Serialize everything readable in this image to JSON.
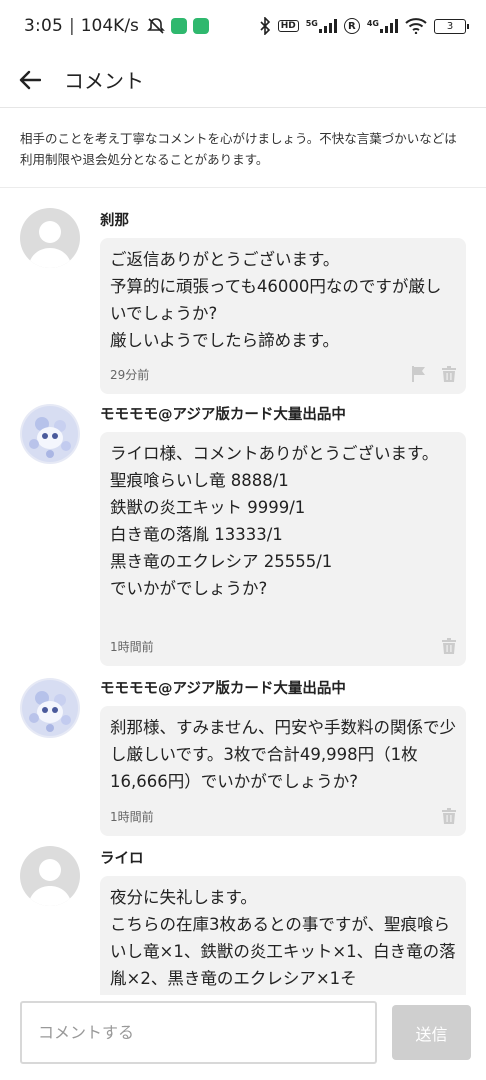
{
  "status_bar": {
    "time": "3:05",
    "separator": "|",
    "network_speed": "104K/s",
    "battery_level": "3",
    "hd_label": "HD",
    "sig1_label": "5G",
    "sig2_label": "4G",
    "r_label": "R",
    "icons": [
      "muted-notifications-icon",
      "shield-app-icon",
      "chat-app-icon",
      "bluetooth-icon",
      "hd-icon",
      "signal-5g-icon",
      "roaming-icon",
      "signal-4g-icon",
      "wifi-icon",
      "battery-icon"
    ]
  },
  "app_bar": {
    "title": "コメント",
    "back_icon": "back-arrow-icon"
  },
  "notice": {
    "text": "相手のことを考え丁寧なコメントを心がけましょう。不快な言葉づかいなどは利用制限や退会処分となることがあります。"
  },
  "comments": [
    {
      "author": "刹那",
      "avatar": "default-avatar",
      "text": "ご返信ありがとうございます。\n予算的に頑張っても46000円なのですが厳しいでしょうか?\n厳しいようでしたら諦めます。",
      "time": "29分前",
      "actions": [
        "flag-icon",
        "trash-icon"
      ]
    },
    {
      "author": "モモモモ@アジア版カード大量出品中",
      "avatar": "seller-avatar",
      "text": "ライロ様、コメントありがとうございます。\n聖痕喰らいし竜 8888/1\n鉄獣の炎工キット 9999/1\n白き竜の落胤 13333/1\n黒き竜のエクレシア 25555/1\nでいかがでしょうか?",
      "time": "1時間前",
      "actions": [
        "trash-icon"
      ]
    },
    {
      "author": "モモモモ@アジア版カード大量出品中",
      "avatar": "seller-avatar",
      "text": "刹那様、すみません、円安や手数料の関係で少し厳しいです。3枚で合計49,998円（1枚16,666円）でいかがでしょうか?",
      "time": "1時間前",
      "actions": [
        "trash-icon"
      ]
    },
    {
      "author": "ライロ",
      "avatar": "default-avatar",
      "text": "夜分に失礼します。\nこちらの在庫3枚あるとの事ですが、聖痕喰らいし竜×1、鉄獣の炎工キット×1、白き竜の落胤×2、黒き竜のエクレシア×1そ",
      "time": "",
      "actions": []
    }
  ],
  "input": {
    "placeholder": "コメントする",
    "value": ""
  },
  "send_button": {
    "label": "送信"
  },
  "colors": {
    "bubble_bg": "#f2f2f2",
    "send_disabled": "#cfcfcf",
    "icon_gray": "#cccccc",
    "status_green": "#2fb86e"
  }
}
